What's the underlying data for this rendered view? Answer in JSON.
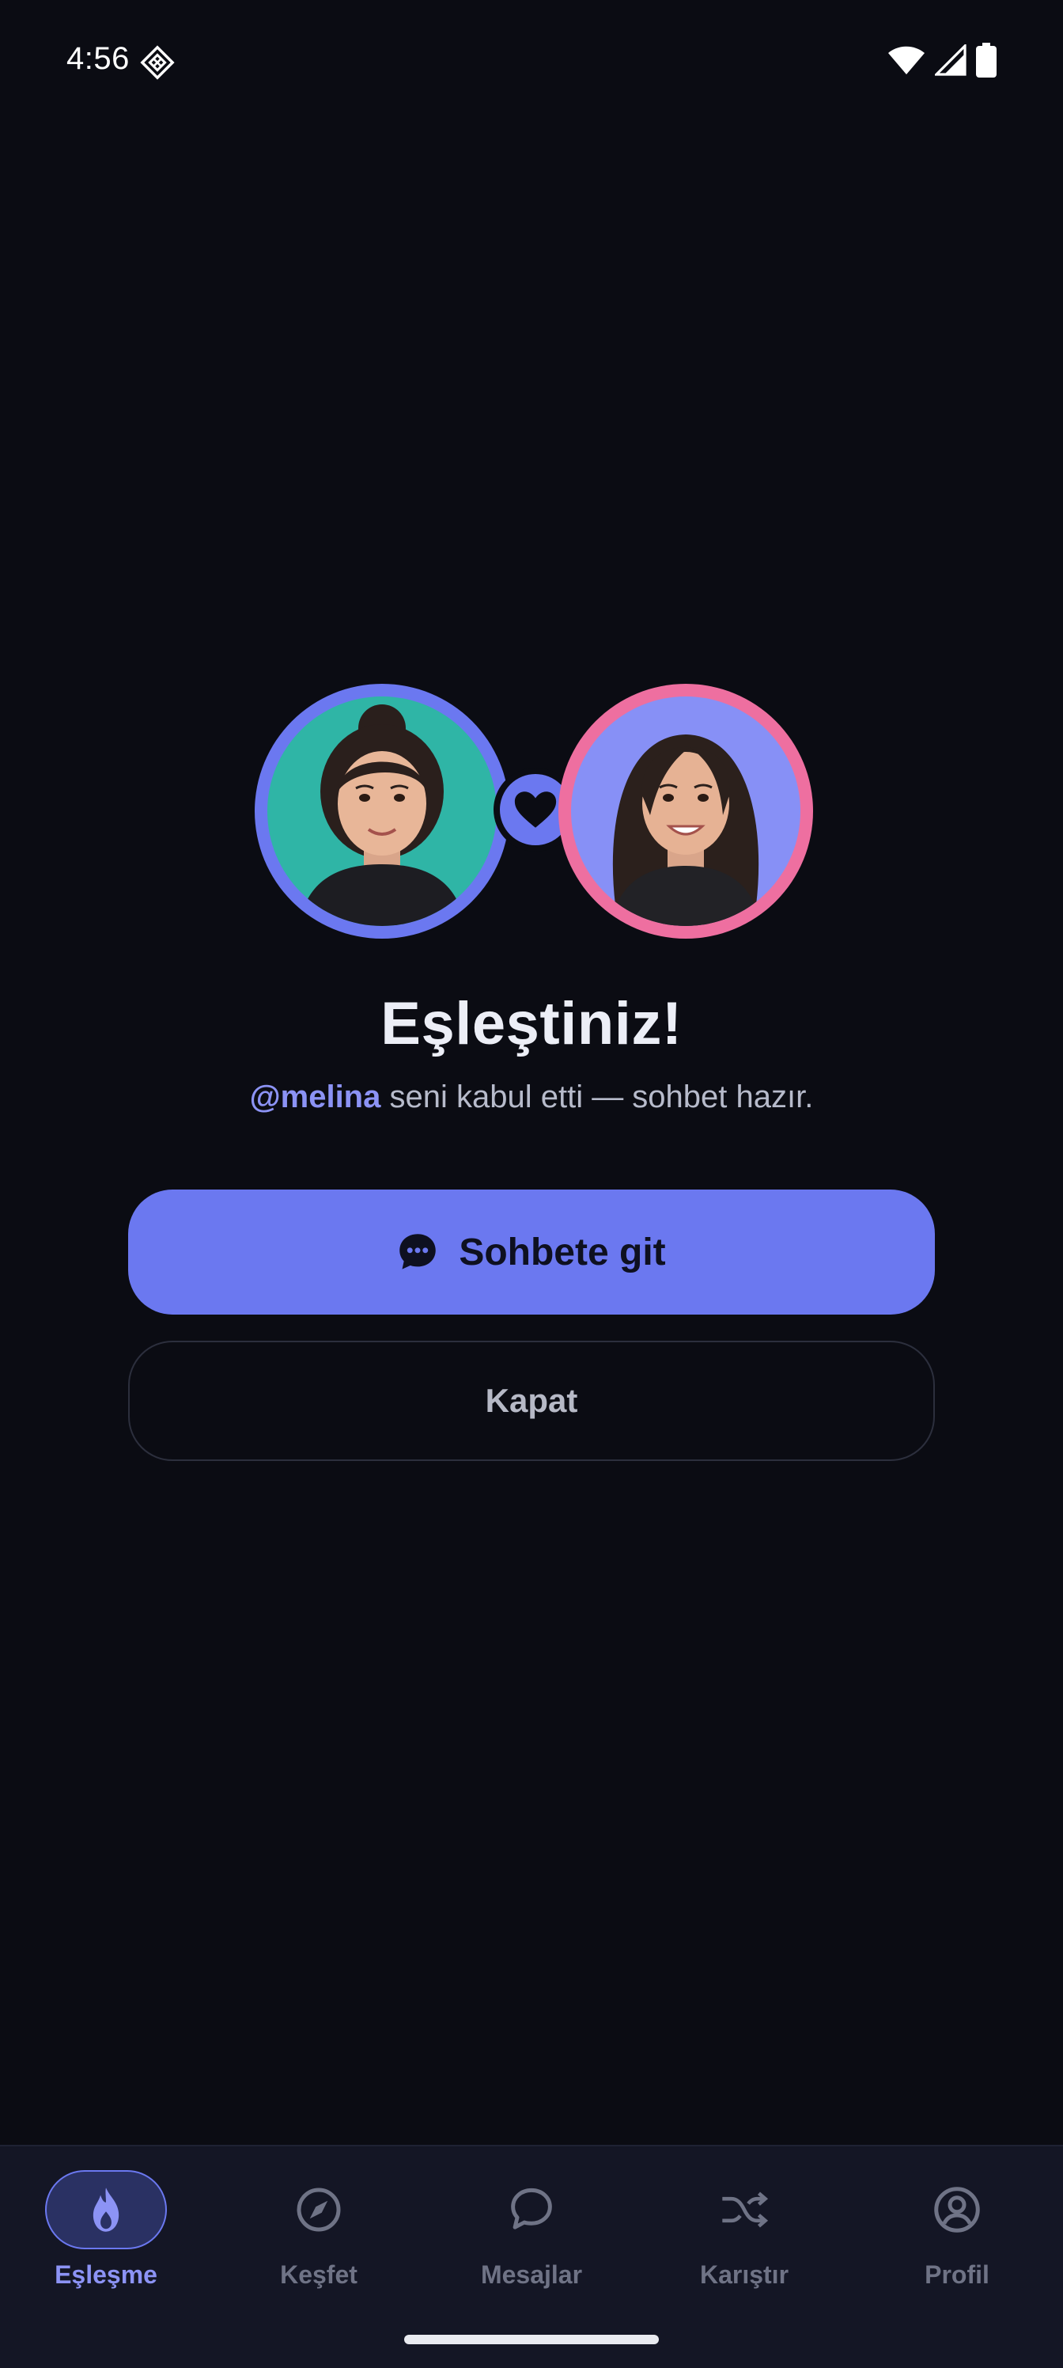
{
  "status_bar": {
    "time": "4:56"
  },
  "match": {
    "title": "Eşleştiniz!",
    "handle": "@melina",
    "subtitle_rest": " seni kabul etti — sohbet hazır."
  },
  "actions": {
    "primary_label": "Sohbete git",
    "secondary_label": "Kapat"
  },
  "nav": {
    "items": [
      {
        "label": "Eşleşme",
        "icon": "flame-icon",
        "active": true
      },
      {
        "label": "Keşfet",
        "icon": "compass-icon",
        "active": false
      },
      {
        "label": "Mesajlar",
        "icon": "chat-bubbles-icon",
        "active": false
      },
      {
        "label": "Karıştır",
        "icon": "shuffle-icon",
        "active": false
      },
      {
        "label": "Profil",
        "icon": "profile-icon",
        "active": false
      }
    ]
  },
  "colors": {
    "background": "#0b0c13",
    "accent": "#6b78f0",
    "accent_light": "#8c93f5",
    "pink": "#ee6fa0",
    "nav_background": "#141625"
  }
}
